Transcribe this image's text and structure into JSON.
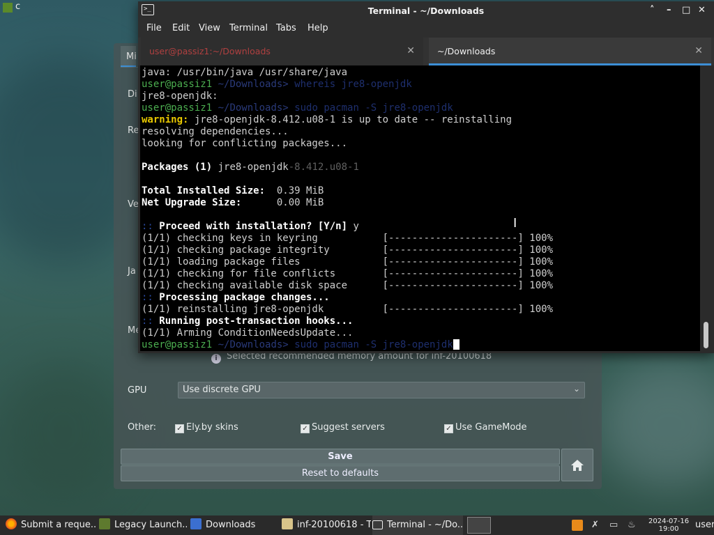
{
  "desktop": {
    "top_left_label": "c"
  },
  "launcher": {
    "tab_partial": "Mi",
    "side_labels": [
      "Di",
      "Re",
      "Ve",
      "Ja",
      "Me"
    ],
    "memory_note": "Selected recommended memory amount for inf-20100618",
    "gpu_label": "GPU",
    "gpu_value": "Use discrete GPU",
    "other_label": "Other:",
    "checkboxes": [
      {
        "label": "Ely.by skins",
        "checked": true
      },
      {
        "label": "Suggest servers",
        "checked": true
      },
      {
        "label": "Use GameMode",
        "checked": true
      }
    ],
    "save_label": "Save",
    "reset_label": "Reset to defaults"
  },
  "terminal": {
    "title": "Terminal - ~/Downloads",
    "menu": [
      "File",
      "Edit",
      "View",
      "Terminal",
      "Tabs",
      "Help"
    ],
    "tabs": [
      {
        "label": "user@passiz1:~/Downloads",
        "active": false
      },
      {
        "label": "~/Downloads",
        "active": true
      }
    ],
    "lines": {
      "l1": "java: /usr/bin/java /usr/share/java",
      "prompt_user": "user@passiz1",
      "prompt_dir": "~/Downloads>",
      "cmd1": "whereis jre8-openjdk",
      "l3": "jre8-openjdk:",
      "cmd2": "sudo pacman -S jre8-openjdk",
      "warning_label": "warning:",
      "warning_text": " jre8-openjdk-8.412.u08-1 is up to date -- reinstalling",
      "l6": "resolving dependencies...",
      "l7": "looking for conflicting packages...",
      "packages_label": "Packages (1)",
      "packages_name": " jre8-openjdk",
      "packages_ver": "-8.412.u08-1",
      "total_label": "Total Installed Size:",
      "total_value": "  0.39 MiB",
      "net_label": "Net Upgrade Size:",
      "net_value": "      0.00 MiB",
      "proceed_marker": "::",
      "proceed_text": " Proceed with installation? [Y/n]",
      "proceed_answer": " y",
      "steps": [
        {
          "text": "(1/1) checking keys in keyring           ",
          "bar": "[----------------------] 100%"
        },
        {
          "text": "(1/1) checking package integrity         ",
          "bar": "[----------------------] 100%"
        },
        {
          "text": "(1/1) loading package files              ",
          "bar": "[----------------------] 100%"
        },
        {
          "text": "(1/1) checking for file conflicts        ",
          "bar": "[----------------------] 100%"
        },
        {
          "text": "(1/1) checking available disk space      ",
          "bar": "[----------------------] 100%"
        }
      ],
      "processing": " Processing package changes...",
      "reinstall": {
        "text": "(1/1) reinstalling jre8-openjdk          ",
        "bar": "[----------------------] 100%"
      },
      "hooks": " Running post-transaction hooks...",
      "arming": "(1/1) Arming ConditionNeedsUpdate...",
      "cmd_last": "sudo pacman -S jre8-openjdk"
    }
  },
  "taskbar": {
    "items": [
      {
        "label": "Submit a reque...",
        "icon": "firefox-icon"
      },
      {
        "label": "Legacy Launch...",
        "icon": "minecraft-icon"
      },
      {
        "label": "Downloads",
        "icon": "file-manager-icon"
      },
      {
        "label": "inf-20100618 - T...",
        "icon": "folder-icon"
      },
      {
        "label": "Terminal - ~/Do...",
        "icon": "terminal-icon"
      }
    ],
    "clock_date": "2024-07-16",
    "clock_time": "19:00",
    "user": "user"
  }
}
